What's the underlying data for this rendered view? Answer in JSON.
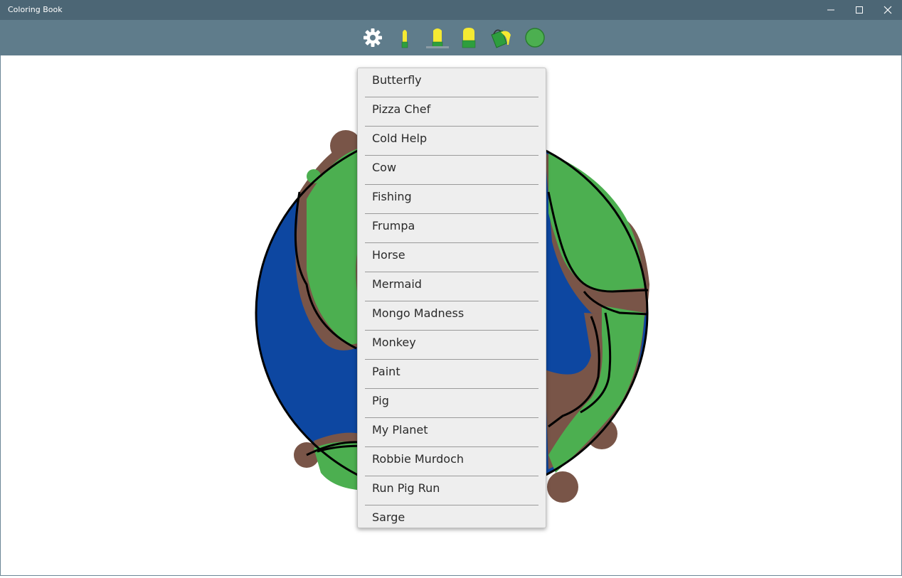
{
  "window": {
    "title": "Coloring Book"
  },
  "toolbar": {
    "tools": [
      {
        "name": "settings",
        "icon": "gear-icon"
      },
      {
        "name": "thin-marker",
        "icon": "thin-marker-icon"
      },
      {
        "name": "medium-marker",
        "icon": "medium-marker-icon",
        "selected": true
      },
      {
        "name": "thick-marker",
        "icon": "thick-marker-icon"
      },
      {
        "name": "paint-bucket",
        "icon": "paint-bucket-icon"
      },
      {
        "name": "color-swatch",
        "icon": "color-swatch-icon",
        "color": "#4caf50"
      }
    ]
  },
  "menu": {
    "items": [
      "Butterfly",
      "Pizza Chef",
      "Cold Help",
      "Cow",
      "Fishing",
      "Frumpa",
      "Horse",
      "Mermaid",
      "Mongo Madness",
      "Monkey",
      "Paint",
      "Pig",
      "My Planet",
      "Robbie Murdoch",
      "Run Pig Run",
      "Sarge"
    ]
  },
  "colors": {
    "titlebar": "#4c6675",
    "toolbar": "#5f7c8b",
    "ocean": "#0d47a1",
    "land": "#4caf50",
    "dirt": "#795548",
    "marker_yellow": "#f5e932",
    "marker_green": "#2e9e3e"
  }
}
